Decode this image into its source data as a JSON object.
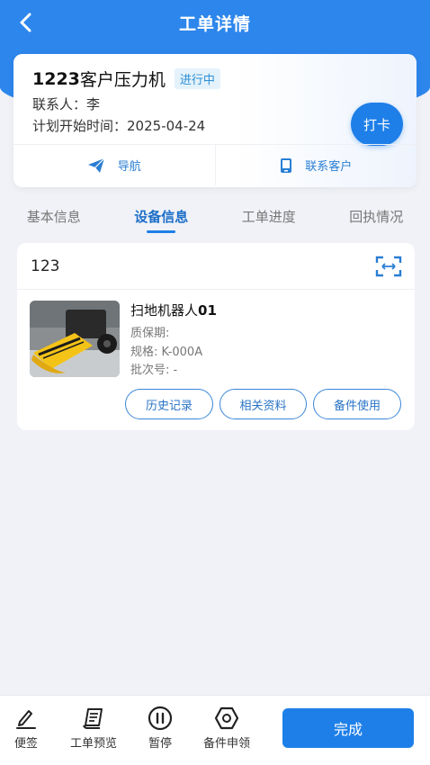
{
  "header": {
    "title": "工单详情",
    "back_icon": "chevron-left-icon",
    "bg_color": "#2d86ec"
  },
  "summary": {
    "title_strong": "1223",
    "title_rest": "客户压力机",
    "status": "进行中",
    "contact_label": "联系人：",
    "contact_value": "李",
    "date_label": "计划开始时间：",
    "date_value": "2025-04-24",
    "punch_label": "打卡",
    "actions": {
      "navigate": {
        "label": "导航",
        "icon": "paper-plane-icon"
      },
      "contact": {
        "label": "联系客户",
        "icon": "phone-icon"
      }
    }
  },
  "tabs": [
    {
      "label": "基本信息",
      "active": false
    },
    {
      "label": "设备信息",
      "active": true
    },
    {
      "label": "工单进度",
      "active": false
    },
    {
      "label": "回执情况",
      "active": false
    }
  ],
  "equipment": {
    "search_value": "123",
    "scan_icon": "scan-icon",
    "device": {
      "name_prefix": "扫地机器人",
      "name_suffix": "01",
      "warranty_label": "质保期:",
      "warranty_value": "",
      "spec_label": "规格:",
      "spec_value": "K-000A",
      "batch_label": "批次号:",
      "batch_value": "-"
    },
    "buttons": {
      "history": "历史记录",
      "docs": "相关资料",
      "parts": "备件使用"
    }
  },
  "bottom": {
    "tools": [
      {
        "label": "便签",
        "icon": "pen-icon"
      },
      {
        "label": "工单预览",
        "icon": "document-icon"
      },
      {
        "label": "暂停",
        "icon": "pause-icon"
      },
      {
        "label": "备件申领",
        "icon": "hex-nut-icon"
      }
    ],
    "complete_label": "完成",
    "accent": "#1e7fe8"
  }
}
